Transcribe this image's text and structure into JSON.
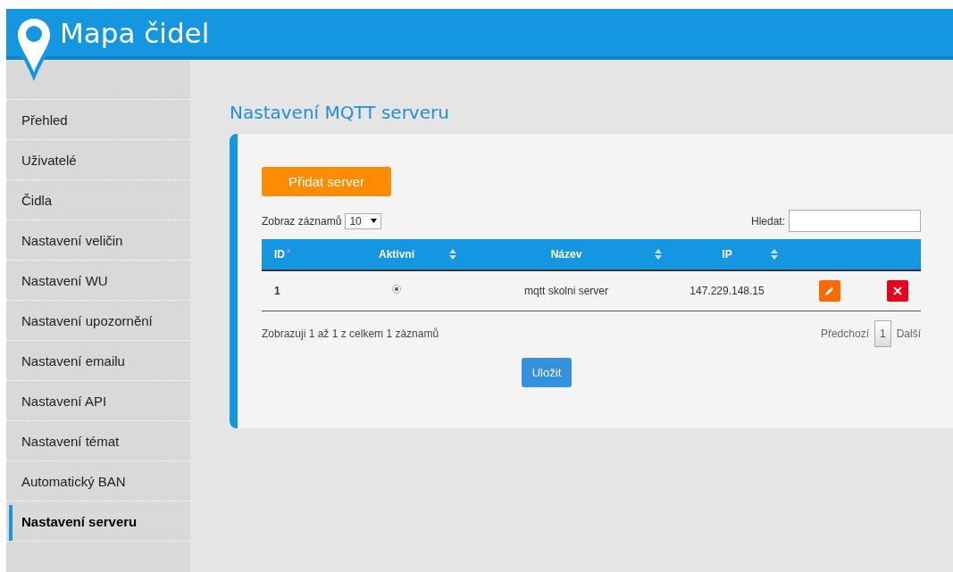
{
  "header": {
    "title": "Mapa čidel"
  },
  "sidebar": {
    "items": [
      {
        "label": "Přehled",
        "selected": false
      },
      {
        "label": "Uživatelé",
        "selected": false
      },
      {
        "label": "Čidla",
        "selected": false
      },
      {
        "label": "Nastavení veličin",
        "selected": false
      },
      {
        "label": "Nastavení WU",
        "selected": false
      },
      {
        "label": "Nastavení upozornění",
        "selected": false
      },
      {
        "label": "Nastavení emailu",
        "selected": false
      },
      {
        "label": "Nastavení API",
        "selected": false
      },
      {
        "label": "Nastavení témat",
        "selected": false
      },
      {
        "label": "Automatický BAN",
        "selected": false
      },
      {
        "label": "Nastavení serveru",
        "selected": true
      }
    ]
  },
  "page_title": "Nastavení MQTT serveru",
  "add_button": "Přidat server",
  "length_label": "Zobraz záznamů",
  "length_value": "10",
  "search_label": "Hledat:",
  "table": {
    "columns": [
      {
        "label": "ID",
        "sorted": true
      },
      {
        "label": "Aktivní",
        "sorted": false
      },
      {
        "label": "Název",
        "sorted": false
      },
      {
        "label": "IP",
        "sorted": false
      }
    ],
    "rows": [
      {
        "id": "1",
        "active": true,
        "name": "mqtt skolni server",
        "ip": "147.229.148.15"
      }
    ]
  },
  "info": "Zobrazuji 1 až 1 z celkem 1 záznamů",
  "pagination": {
    "previous": "Předchozí",
    "pages": [
      {
        "label": "1",
        "selected": true
      }
    ],
    "next": "Další"
  },
  "save_button": "Uložit"
}
